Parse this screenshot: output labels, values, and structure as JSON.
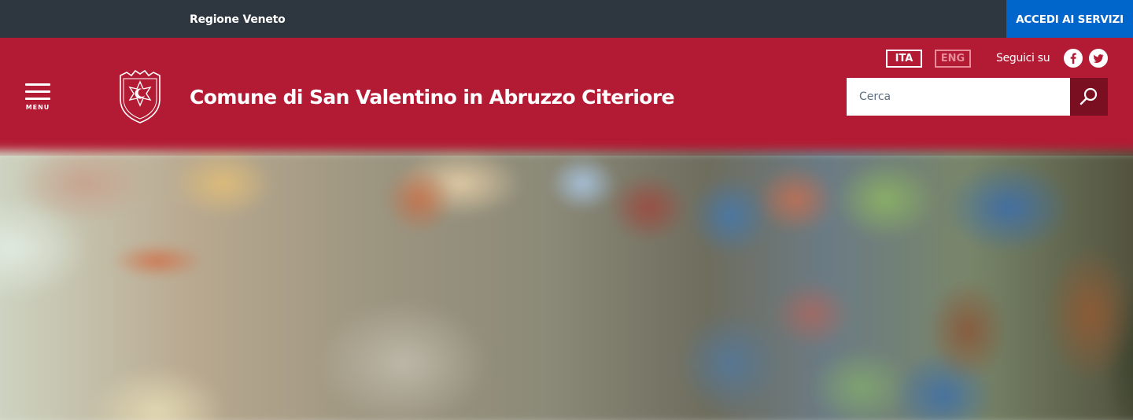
{
  "slim_header": {
    "region_label": "Regione Veneto",
    "services_label": "ACCEDI AI SERVIZI"
  },
  "header": {
    "menu_label": "MENU",
    "site_title": "Comune di San Valentino in Abruzzo Citeriore",
    "languages": [
      {
        "label": "ITA",
        "active": true
      },
      {
        "label": "ENG",
        "active": false
      }
    ],
    "follow_label": "Seguici su",
    "social": [
      "facebook-icon",
      "twitter-icon"
    ],
    "search": {
      "placeholder": "Cerca",
      "value": ""
    }
  },
  "colors": {
    "slim_bg": "#2e3640",
    "services_bg": "#0066cc",
    "header_bg": "#b31b34",
    "search_button_bg": "#7a0f22"
  }
}
